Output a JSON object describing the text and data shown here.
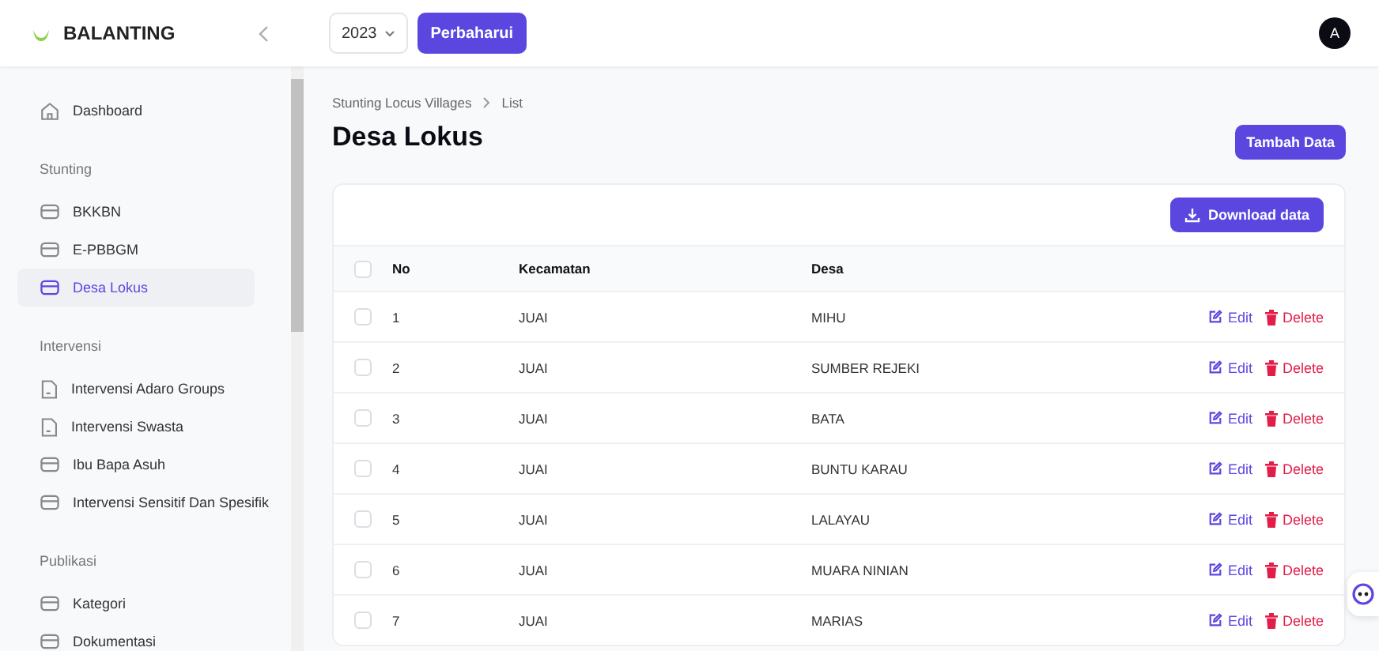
{
  "brand": {
    "name": "BALANTING"
  },
  "header": {
    "year": "2023",
    "refresh_button": "Perbaharui",
    "avatar": "A"
  },
  "sidebar": {
    "sections": [
      {
        "items": [
          {
            "label": "Dashboard",
            "kind": "home",
            "selected": false
          }
        ]
      },
      {
        "title": "Stunting",
        "items": [
          {
            "label": "BKKBN",
            "kind": "tray",
            "selected": false
          },
          {
            "label": "E-PBBGM",
            "kind": "tray",
            "selected": false
          },
          {
            "label": "Desa Lokus",
            "kind": "tray",
            "selected": true
          }
        ]
      },
      {
        "title": "Intervensi",
        "items": [
          {
            "label": "Intervensi Adaro Groups",
            "kind": "doc",
            "selected": false
          },
          {
            "label": "Intervensi Swasta",
            "kind": "doc",
            "selected": false
          },
          {
            "label": "Ibu Bapa Asuh",
            "kind": "tray",
            "selected": false
          },
          {
            "label": "Intervensi Sensitif Dan Spesifik",
            "kind": "tray",
            "selected": false
          }
        ]
      },
      {
        "title": "Publikasi",
        "items": [
          {
            "label": "Kategori",
            "kind": "tray",
            "selected": false
          },
          {
            "label": "Dokumentasi",
            "kind": "tray",
            "selected": false
          }
        ]
      }
    ]
  },
  "breadcrumb": [
    "Stunting Locus Villages",
    "List"
  ],
  "page_title": "Desa Lokus",
  "add_button": "Tambah Data",
  "download_button": "Download data",
  "table": {
    "select_all": {
      "checked": false
    },
    "columns": [
      "No",
      "Kecamatan",
      "Desa"
    ],
    "rows": [
      {
        "no": "1",
        "kecamatan": "JUAI",
        "desa": "MIHU",
        "checked": false,
        "edit": "Edit",
        "delete": "Delete"
      },
      {
        "no": "2",
        "kecamatan": "JUAI",
        "desa": "SUMBER REJEKI",
        "checked": false,
        "edit": "Edit",
        "delete": "Delete"
      },
      {
        "no": "3",
        "kecamatan": "JUAI",
        "desa": "BATA",
        "checked": false,
        "edit": "Edit",
        "delete": "Delete"
      },
      {
        "no": "4",
        "kecamatan": "JUAI",
        "desa": "BUNTU KARAU",
        "checked": false,
        "edit": "Edit",
        "delete": "Delete"
      },
      {
        "no": "5",
        "kecamatan": "JUAI",
        "desa": "LALAYAU",
        "checked": false,
        "edit": "Edit",
        "delete": "Delete"
      },
      {
        "no": "6",
        "kecamatan": "JUAI",
        "desa": "MUARA NINIAN",
        "checked": false,
        "edit": "Edit",
        "delete": "Delete"
      },
      {
        "no": "7",
        "kecamatan": "JUAI",
        "desa": "MARIAS",
        "checked": false,
        "edit": "Edit",
        "delete": "Delete"
      }
    ]
  }
}
